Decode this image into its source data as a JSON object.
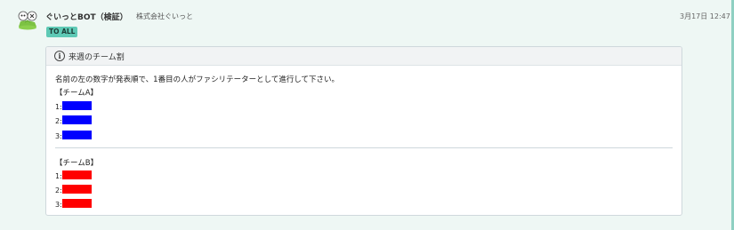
{
  "message": {
    "sender": "ぐいっとBOT（検証）",
    "company": "株式会社ぐいっと",
    "timestamp": "3月17日 12:47",
    "badge": "TO ALL"
  },
  "card": {
    "info_icon": "i",
    "title": "来週のチーム割",
    "instruction": "名前の左の数字が発表順で、1番目の人がファシリテーターとして進行して下さい。",
    "team_a": {
      "label": "【チームA】",
      "color": "#0000ff",
      "entries": [
        "1:",
        "2:",
        "3:"
      ]
    },
    "team_b": {
      "label": "【チームB】",
      "color": "#ff0000",
      "entries": [
        "1:",
        "2:",
        "3:"
      ]
    }
  },
  "colors": {
    "accent": "#5ec9b5",
    "background": "#eef7f4"
  }
}
